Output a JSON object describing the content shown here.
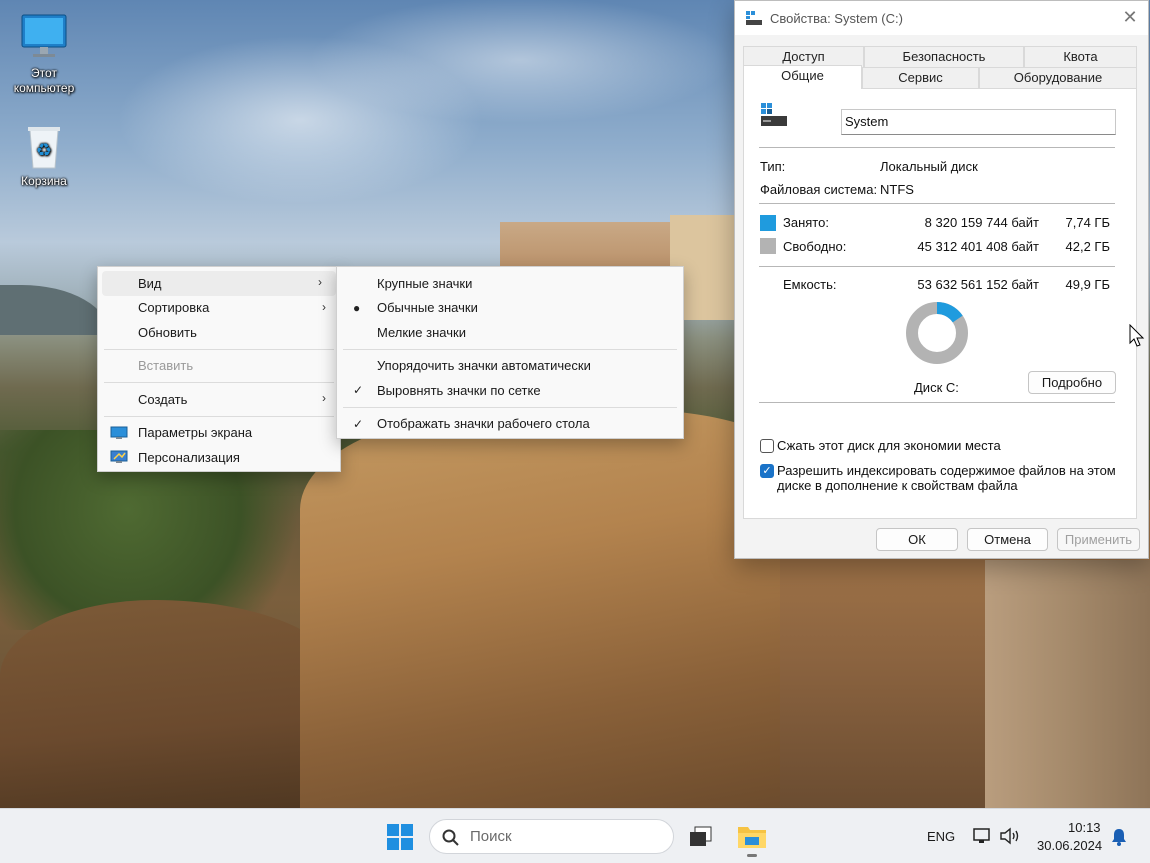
{
  "desktop": {
    "icons": [
      {
        "label": "Этот компьютер"
      },
      {
        "label": "Корзина"
      }
    ]
  },
  "context_menu": {
    "items": [
      {
        "label": "Вид",
        "submenu": true,
        "highlighted": true
      },
      {
        "label": "Сортировка",
        "submenu": true
      },
      {
        "label": "Обновить"
      },
      {
        "label": "Вставить",
        "disabled": true
      },
      {
        "label": "Создать",
        "submenu": true
      },
      {
        "label": "Параметры экрана",
        "icon": "display-icon"
      },
      {
        "label": "Персонализация",
        "icon": "personalize-icon"
      }
    ],
    "view_submenu": [
      {
        "label": "Крупные значки"
      },
      {
        "label": "Обычные значки",
        "selected": true
      },
      {
        "label": "Мелкие значки"
      },
      {
        "label": "Упорядочить значки автоматически"
      },
      {
        "label": "Выровнять значки по сетке",
        "checked": true
      },
      {
        "label": "Отображать значки рабочего стола",
        "checked": true
      }
    ]
  },
  "dialog": {
    "title": "Свойства: System (C:)",
    "tabs_row1": [
      "Доступ",
      "Безопасность",
      "Квота"
    ],
    "tabs_row2": [
      "Общие",
      "Сервис",
      "Оборудование"
    ],
    "active_tab": "Общие",
    "volume_name": "System",
    "type_label": "Тип:",
    "type_value": "Локальный диск",
    "fs_label": "Файловая система:",
    "fs_value": "NTFS",
    "used_label": "Занято:",
    "used_bytes": "8 320 159 744 байт",
    "used_size": "7,74 ГБ",
    "free_label": "Свободно:",
    "free_bytes": "45 312 401 408 байт",
    "free_size": "42,2 ГБ",
    "capacity_label": "Емкость:",
    "capacity_bytes": "53 632 561 152 байт",
    "capacity_size": "49,9 ГБ",
    "used_fraction": 0.155,
    "disk_label": "Диск C:",
    "details_button": "Подробно",
    "compress_label": "Сжать этот диск для экономии места",
    "compress_checked": false,
    "index_label_line1": "Разрешить индексировать содержимое файлов на этом",
    "index_label_line2": "диске в дополнение к свойствам файла",
    "index_checked": true,
    "ok_button": "ОК",
    "cancel_button": "Отмена",
    "apply_button": "Применить",
    "colors": {
      "used": "#1f9bde",
      "free": "#b3b3b3"
    }
  },
  "taskbar": {
    "search_placeholder": "Поиск",
    "language": "ENG",
    "time": "10:13",
    "date": "30.06.2024"
  }
}
